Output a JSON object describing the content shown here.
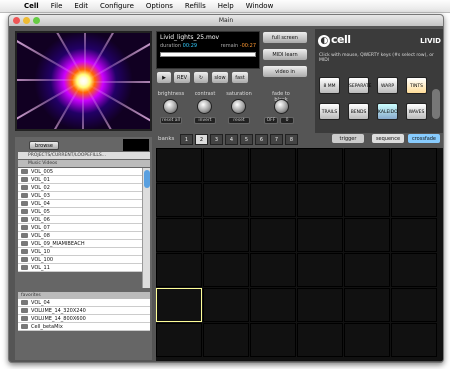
{
  "menubar": {
    "app": "Cell",
    "items": [
      "File",
      "Edit",
      "Configure",
      "Options",
      "Refills",
      "Help",
      "Window"
    ]
  },
  "window": {
    "title": "Main"
  },
  "clip": {
    "name": "Livid_lights_25.mov",
    "duration_label": "duration",
    "duration": "00:29",
    "remain_label": "remain",
    "remain": "-00:27"
  },
  "transport": {
    "rev": "REV",
    "slow": "slow",
    "fast": "fast"
  },
  "buttons": {
    "full_screen": "full screen",
    "midi_learn": "MIDI learn",
    "video_in": "video in"
  },
  "knobs": [
    {
      "label": "brightness",
      "reset": "reset all"
    },
    {
      "label": "contrast",
      "reset": "invert"
    },
    {
      "label": "saturation",
      "reset": "reset"
    },
    {
      "label": "fade to black",
      "off": "OFF",
      "val": "0"
    }
  ],
  "banks": {
    "label": "banks",
    "items": [
      "1",
      "2",
      "3",
      "4",
      "5",
      "6",
      "7",
      "8"
    ],
    "selected": 1
  },
  "trigger": "trigger",
  "sequence": "sequence",
  "crossfade": "crossfade",
  "cell": {
    "logo": "cell",
    "brand": "LIVID",
    "hint": "Click with mouse, QWERTY keys (#s select row), or MIDI"
  },
  "fx": [
    "8 MM",
    "SEPARATE",
    "WARP",
    "TINTS",
    "TRAILS",
    "BENDS",
    "KALEIDO",
    "WAVES"
  ],
  "browser": {
    "browse": "browse",
    "path": "PROJECTS/CURRENT/LOOPEFILLS...",
    "header": "Music Videos",
    "folders": [
      "VOL_005",
      "VOL_01",
      "VOL_02",
      "VOL_03",
      "VOL_04",
      "VOL_05",
      "VOL_06",
      "VOL_07",
      "VOL_08",
      "VOL_09_MIAMIBEACH",
      "VOL_10",
      "VOL_100",
      "VOL_11"
    ],
    "favorites_label": "favorites",
    "favorites": [
      "VOL_04",
      "VOLUME_14_320X240",
      "VOLUME_14_800X600",
      "Cell_betaMix"
    ]
  },
  "colors": {
    "accent": "#4aa3e0",
    "window_bg": "#555555"
  }
}
